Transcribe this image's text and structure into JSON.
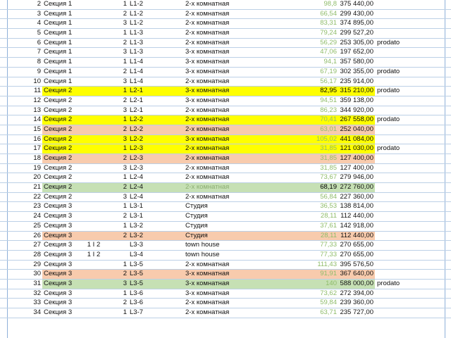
{
  "rows": [
    {
      "num": "2",
      "section": "Секция 1",
      "group": "",
      "sub": "1",
      "code": "L1-2",
      "type": "2-х комнатная",
      "area": "98,8",
      "price": "375 440,00",
      "note": "",
      "hl": ""
    },
    {
      "num": "3",
      "section": "Секция 1",
      "group": "",
      "sub": "2",
      "code": "L1-2",
      "type": "2-х комнатная",
      "area": "66,54",
      "price": "299 430,00",
      "note": "",
      "hl": ""
    },
    {
      "num": "4",
      "section": "Секция 1",
      "group": "",
      "sub": "3",
      "code": "L1-2",
      "type": "2-х комнатная",
      "area": "83,31",
      "price": "374 895,00",
      "note": "",
      "hl": ""
    },
    {
      "num": "5",
      "section": "Секция 1",
      "group": "",
      "sub": "1",
      "code": "L1-3",
      "type": "2-х комнатная",
      "area": "79,24",
      "price": "299 527,20",
      "note": "",
      "hl": ""
    },
    {
      "num": "6",
      "section": "Секция 1",
      "group": "",
      "sub": "2",
      "code": "L1-3",
      "type": "2-х комнатная",
      "area": "56,29",
      "price": "253 305,00",
      "note": "prodato",
      "hl": ""
    },
    {
      "num": "7",
      "section": "Секция 1",
      "group": "",
      "sub": "3",
      "code": "L1-3",
      "type": "3-х комнатная",
      "area": "47,06",
      "price": "197 652,00",
      "note": "",
      "hl": ""
    },
    {
      "num": "8",
      "section": "Секция 1",
      "group": "",
      "sub": "1",
      "code": "L1-4",
      "type": "3-х комнатная",
      "area": "94,1",
      "price": "357 580,00",
      "note": "",
      "hl": ""
    },
    {
      "num": "9",
      "section": "Секция 1",
      "group": "",
      "sub": "2",
      "code": "L1-4",
      "type": "3-х комнатная",
      "area": "67,19",
      "price": "302 355,00",
      "note": "prodato",
      "hl": ""
    },
    {
      "num": "10",
      "section": "Секция 1",
      "group": "",
      "sub": "3",
      "code": "L1-4",
      "type": "2-х комнатная",
      "area": "56,17",
      "price": "235 914,00",
      "note": "",
      "hl": ""
    },
    {
      "num": "11",
      "section": "Секция 2",
      "group": "",
      "sub": "1",
      "code": "L2-1",
      "type": "3-х комнатная",
      "area": "82,95",
      "price": "315 210,00",
      "note": "prodato",
      "hl": "yellow",
      "areaStrong": true
    },
    {
      "num": "12",
      "section": "Секция 2",
      "group": "",
      "sub": "2",
      "code": "L2-1",
      "type": "3-х комнатная",
      "area": "94,51",
      "price": "359 138,00",
      "note": "",
      "hl": ""
    },
    {
      "num": "13",
      "section": "Секция 2",
      "group": "",
      "sub": "3",
      "code": "L2-1",
      "type": "2-х комнатная",
      "area": "86,23",
      "price": "344 920,00",
      "note": "",
      "hl": ""
    },
    {
      "num": "14",
      "section": "Секция 2",
      "group": "",
      "sub": "1",
      "code": "L2-2",
      "type": "2-х комнатная",
      "area": "70,41",
      "price": "267 558,00",
      "note": "prodato",
      "hl": "yellow"
    },
    {
      "num": "15",
      "section": "Секция 2",
      "group": "",
      "sub": "2",
      "code": "L2-2",
      "type": "2-х комнатная",
      "area": "63,01",
      "price": "252 040,00",
      "note": "",
      "hl": "peach"
    },
    {
      "num": "16",
      "section": "Секция 2",
      "group": "",
      "sub": "3",
      "code": "L2-2",
      "type": "3-х комнатная",
      "area": "105,02",
      "price": "441 084,00",
      "note": "",
      "hl": "yellow"
    },
    {
      "num": "17",
      "section": "Секция 2",
      "group": "",
      "sub": "1",
      "code": "L2-3",
      "type": "2-х комнатная",
      "area": "31,85",
      "price": "121 030,00",
      "note": "prodato",
      "hl": "yellow"
    },
    {
      "num": "18",
      "section": "Секция 2",
      "group": "",
      "sub": "2",
      "code": "L2-3",
      "type": "2-х комнатная",
      "area": "31,85",
      "price": "127 400,00",
      "note": "",
      "hl": "peach"
    },
    {
      "num": "19",
      "section": "Секция 2",
      "group": "",
      "sub": "3",
      "code": "L2-3",
      "type": "2-х комнатная",
      "area": "31,85",
      "price": "127 400,00",
      "note": "",
      "hl": ""
    },
    {
      "num": "20",
      "section": "Секция 2",
      "group": "",
      "sub": "1",
      "code": "L2-4",
      "type": "2-х комнатная",
      "area": "73,67",
      "price": "279 946,00",
      "note": "",
      "hl": ""
    },
    {
      "num": "21",
      "section": "Секция 2",
      "group": "",
      "sub": "2",
      "code": "L2-4",
      "type": "2-х комнатная",
      "area": "68,19",
      "price": "272 760,00",
      "note": "",
      "hl": "green",
      "areaStrong": true,
      "typeMuted": true
    },
    {
      "num": "22",
      "section": "Секция 2",
      "group": "",
      "sub": "3",
      "code": "L2-4",
      "type": "2-х комнатная",
      "area": "56,84",
      "price": "227 360,00",
      "note": "",
      "hl": ""
    },
    {
      "num": "23",
      "section": "Секция 3",
      "group": "",
      "sub": "1",
      "code": "L3-1",
      "type": "Студия",
      "area": "36,53",
      "price": "138 814,00",
      "note": "",
      "hl": ""
    },
    {
      "num": "24",
      "section": "Секция 3",
      "group": "",
      "sub": "2",
      "code": "L3-1",
      "type": "Студия",
      "area": "28,11",
      "price": "112 440,00",
      "note": "",
      "hl": ""
    },
    {
      "num": "25",
      "section": "Секция 3",
      "group": "",
      "sub": "1",
      "code": "L3-2",
      "type": "Студия",
      "area": "37,61",
      "price": "142 918,00",
      "note": "",
      "hl": ""
    },
    {
      "num": "26",
      "section": "Секция 3",
      "group": "",
      "sub": "2",
      "code": "L3-2",
      "type": "Студия",
      "area": "28,11",
      "price": "112 440,00",
      "note": "",
      "hl": "peach"
    },
    {
      "num": "27",
      "section": "Секция 3",
      "group": "1 I 2",
      "sub": "",
      "code": "L3-3",
      "type": "town house",
      "area": "77,33",
      "price": "270 655,00",
      "note": "",
      "hl": ""
    },
    {
      "num": "28",
      "section": "Секция 3",
      "group": "1 I 2",
      "sub": "",
      "code": "L3-4",
      "type": "town house",
      "area": "77,33",
      "price": "270 655,00",
      "note": "",
      "hl": ""
    },
    {
      "num": "29",
      "section": "Секция 3",
      "group": "",
      "sub": "1",
      "code": "L3-5",
      "type": "2-х комнатная",
      "area": "111,43",
      "price": "395 576,50",
      "note": "",
      "hl": ""
    },
    {
      "num": "30",
      "section": "Секция 3",
      "group": "",
      "sub": "2",
      "code": "L3-5",
      "type": "3-х комнатная",
      "area": "91,91",
      "price": "367 640,00",
      "note": "",
      "hl": "peach"
    },
    {
      "num": "31",
      "section": "Секция 3",
      "group": "",
      "sub": "3",
      "code": "L3-5",
      "type": "3-х комнатная",
      "area": "140",
      "price": "588 000,00",
      "note": "prodato",
      "hl": "green"
    },
    {
      "num": "32",
      "section": "Секция 3",
      "group": "",
      "sub": "1",
      "code": "L3-6",
      "type": "3-х комнатная",
      "area": "73,62",
      "price": "272 394,00",
      "note": "",
      "hl": ""
    },
    {
      "num": "33",
      "section": "Секция 3",
      "group": "",
      "sub": "2",
      "code": "L3-6",
      "type": "2-х комнатная",
      "area": "59,84",
      "price": "239 360,00",
      "note": "",
      "hl": ""
    },
    {
      "num": "34",
      "section": "Секция 3",
      "group": "",
      "sub": "1",
      "code": "L3-7",
      "type": "2-х комнатная",
      "area": "63,71",
      "price": "235 727,00",
      "note": "",
      "hl": ""
    }
  ]
}
